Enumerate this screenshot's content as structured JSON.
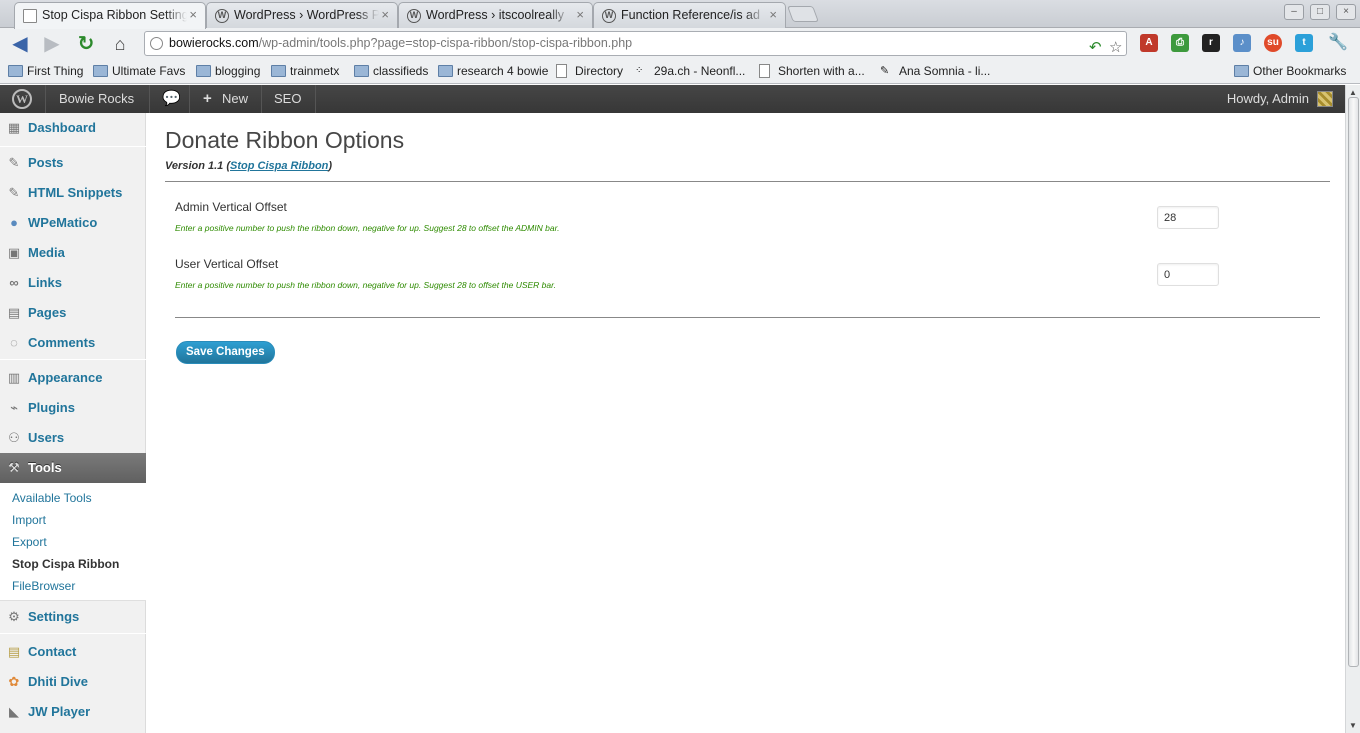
{
  "browser": {
    "tabs": [
      {
        "title": "Stop Cispa Ribbon Setting",
        "active": true,
        "icon": "page-icon"
      },
      {
        "title": "WordPress › WordPress Pl",
        "active": false,
        "icon": "wordpress-icon"
      },
      {
        "title": "WordPress › itscoolreally",
        "active": false,
        "icon": "wordpress-icon"
      },
      {
        "title": "Function Reference/is ad",
        "active": false,
        "icon": "wordpress-icon"
      }
    ],
    "url_host": "bowierocks.com",
    "url_path": "/wp-admin/tools.php?page=stop-cispa-ribbon/stop-cispa-ribbon.php",
    "bookmarks": [
      {
        "label": "First Thing",
        "icon": "folder-icon"
      },
      {
        "label": "Ultimate Favs",
        "icon": "folder-icon"
      },
      {
        "label": "blogging",
        "icon": "folder-icon"
      },
      {
        "label": "trainmetx",
        "icon": "folder-icon"
      },
      {
        "label": "classifieds",
        "icon": "folder-icon"
      },
      {
        "label": "research 4 bowie",
        "icon": "folder-icon"
      },
      {
        "label": "Directory",
        "icon": "page-icon"
      },
      {
        "label": "29a.ch - Neonfl...",
        "icon": "dots-icon"
      },
      {
        "label": "Shorten with a...",
        "icon": "page-icon"
      },
      {
        "label": "Ana Somnia - li...",
        "icon": "feather-icon"
      }
    ],
    "other_bookmarks": "Other Bookmarks"
  },
  "adminbar": {
    "site_name": "Bowie Rocks",
    "new_label": "New",
    "seo_label": "SEO",
    "howdy": "Howdy, Admin"
  },
  "sidebar": {
    "items": [
      {
        "label": "Dashboard",
        "icon": "dashboard-icon"
      },
      {
        "label": "Posts",
        "icon": "pushpin-icon"
      },
      {
        "label": "HTML Snippets",
        "icon": "pushpin-icon"
      },
      {
        "label": "WPeMatico",
        "icon": "wpematico-icon"
      },
      {
        "label": "Media",
        "icon": "media-icon"
      },
      {
        "label": "Links",
        "icon": "link-icon"
      },
      {
        "label": "Pages",
        "icon": "pages-icon"
      },
      {
        "label": "Comments",
        "icon": "comment-icon"
      },
      {
        "label": "Appearance",
        "icon": "appearance-icon"
      },
      {
        "label": "Plugins",
        "icon": "plugin-icon"
      },
      {
        "label": "Users",
        "icon": "users-icon"
      },
      {
        "label": "Tools",
        "icon": "tools-icon"
      },
      {
        "label": "Settings",
        "icon": "settings-icon"
      },
      {
        "label": "Contact",
        "icon": "contact-icon"
      },
      {
        "label": "Dhiti Dive",
        "icon": "lotus-icon"
      },
      {
        "label": "JW Player",
        "icon": "jwplayer-icon"
      }
    ],
    "tools_submenu": [
      "Available Tools",
      "Import",
      "Export",
      "Stop Cispa Ribbon",
      "FileBrowser"
    ]
  },
  "main": {
    "title": "Donate Ribbon Options",
    "version_prefix": "Version 1.1 (",
    "version_link": "Stop Cispa Ribbon",
    "version_suffix": ")",
    "fields": [
      {
        "label": "Admin Vertical Offset",
        "help": "Enter a positive number to push the ribbon down, negative for up. Suggest 28 to offset the ADMIN bar.",
        "value": "28"
      },
      {
        "label": "User Vertical Offset",
        "help": "Enter a positive number to push the ribbon down, negative for up. Suggest 28 to offset the USER bar.",
        "value": "0"
      }
    ],
    "save_label": "Save Changes"
  },
  "colors": {
    "wp_link": "#21759b",
    "help_text": "#2e8b00",
    "admin_bar": "#464646",
    "button": "#21759b"
  }
}
